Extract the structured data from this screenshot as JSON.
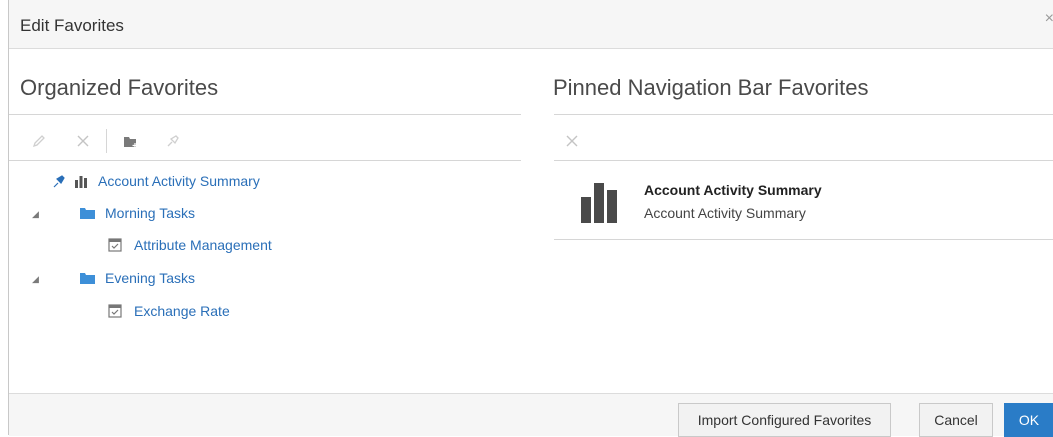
{
  "dialog": {
    "title": "Edit Favorites",
    "close_label": "×"
  },
  "organized": {
    "heading": "Organized Favorites",
    "toolbar": [
      "edit-icon",
      "delete-icon",
      "new-folder-icon",
      "pin-icon"
    ],
    "tree": [
      {
        "label": "Account Activity Summary",
        "icon": "bar-chart-icon",
        "pinned": true
      },
      {
        "label": "Morning Tasks",
        "icon": "folder-icon",
        "expanded": true,
        "children": [
          {
            "label": "Attribute Management",
            "icon": "task-icon"
          }
        ]
      },
      {
        "label": "Evening Tasks",
        "icon": "folder-icon",
        "expanded": true,
        "children": [
          {
            "label": "Exchange Rate",
            "icon": "task-icon"
          }
        ]
      }
    ]
  },
  "pinned": {
    "heading": "Pinned Navigation Bar Favorites",
    "toolbar": [
      "delete-icon"
    ],
    "items": [
      {
        "title": "Account Activity Summary",
        "subtitle": "Account Activity Summary",
        "icon": "bar-chart-icon"
      }
    ]
  },
  "footer": {
    "import_label": "Import Configured Favorites",
    "cancel_label": "Cancel",
    "ok_label": "OK"
  },
  "colors": {
    "link": "#2a6fb8",
    "primary": "#2a7cc7",
    "folder": "#3d8fd8"
  }
}
